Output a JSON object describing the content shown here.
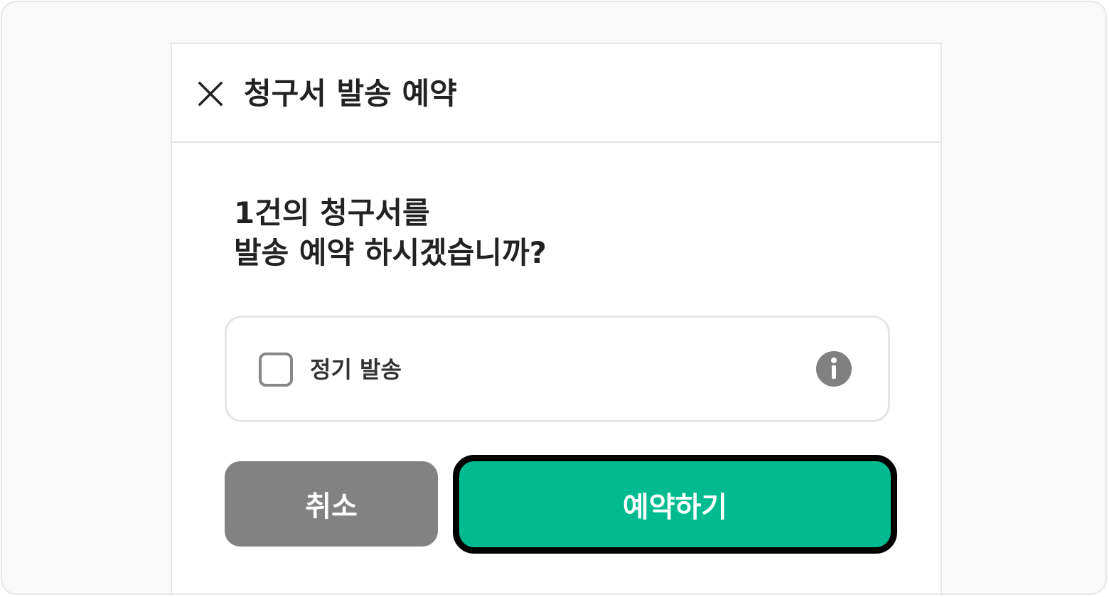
{
  "dialog": {
    "title": "청구서 발송 예약",
    "close_icon": "close-icon",
    "question_line1": "1건의 청구서를",
    "question_line2": "발송 예약 하시겠습니까?",
    "option": {
      "label": "정기 발송",
      "checked": false,
      "info_icon": "info-icon"
    },
    "buttons": {
      "cancel_label": "취소",
      "confirm_label": "예약하기"
    }
  },
  "colors": {
    "accent": "#00bb8f",
    "cancel": "#828282",
    "text": "#222222",
    "border": "#e6e6e6"
  }
}
